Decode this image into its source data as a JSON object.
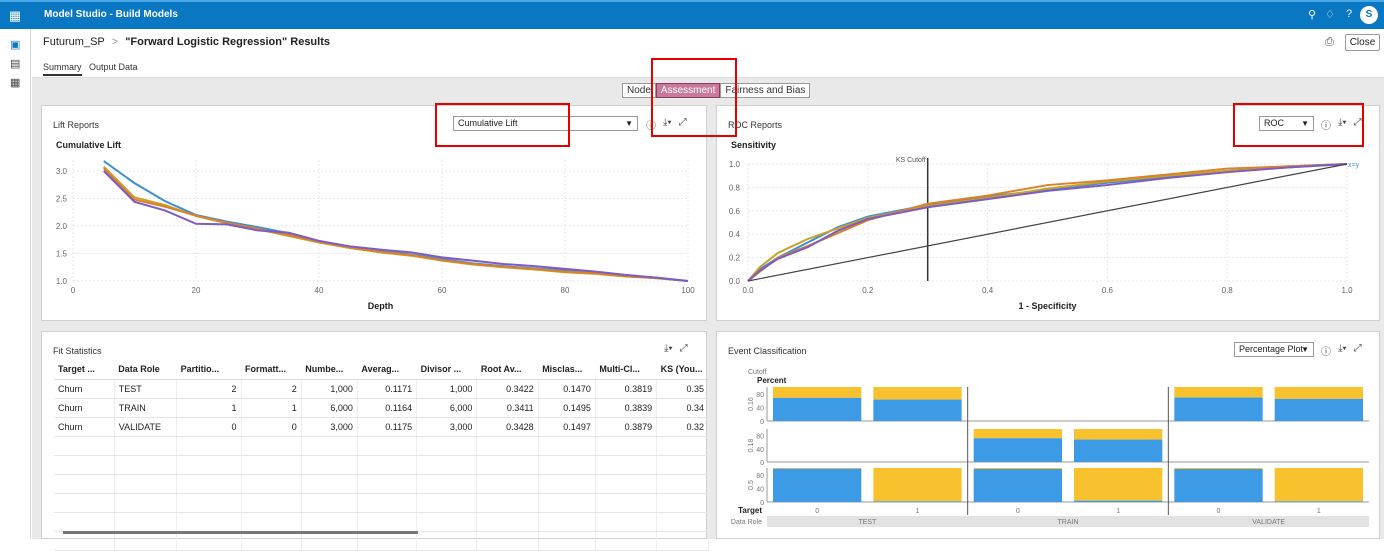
{
  "app": {
    "title": "Model Studio - Build Models",
    "apps_icon": "grid-icon",
    "avatar": "S"
  },
  "header_icons": [
    "search-icon",
    "notification-icon",
    "help-icon"
  ],
  "header_help": "?",
  "breadcrumb": {
    "project": "Futurum_SP",
    "separator": ">",
    "current": "\"Forward Logistic Regression\" Results"
  },
  "close_label": "Close",
  "tabs": {
    "summary": "Summary",
    "output": "Output Data"
  },
  "segments": {
    "node": "Node",
    "assessment": "Assessment",
    "fairness": "Fairness and Bias"
  },
  "lift": {
    "title": "Lift Reports",
    "select": "Cumulative Lift",
    "chart_title": "Cumulative Lift",
    "yticks": [
      "3.0",
      "2.5",
      "2.0",
      "1.5",
      "1.0"
    ],
    "xticks": [
      "0",
      "20",
      "40",
      "60",
      "80",
      "100"
    ],
    "xlabel": "Depth"
  },
  "roc": {
    "title": "ROC Reports",
    "select": "ROC",
    "chart_title": "Sensitivity",
    "yticks": [
      "1.0",
      "0.8",
      "0.6",
      "0.4",
      "0.2",
      "0.0"
    ],
    "xticks": [
      "0.0",
      "0.2",
      "0.4",
      "0.6",
      "0.8",
      "1.0"
    ],
    "xlabel": "1 - Specificity",
    "ks": "KS Cutoff",
    "xy_label": "x=y"
  },
  "fit": {
    "title": "Fit Statistics",
    "headers": [
      "Target ...",
      "Data Role",
      "Partitio...",
      "Formatt...",
      "Numbe...",
      "Averag...",
      "Divisor ...",
      "Root Av...",
      "Misclas...",
      "Multi-Cl...",
      "KS (You..."
    ],
    "rows": [
      [
        "Churn",
        "TEST",
        "2",
        "2",
        "1,000",
        "0.1171",
        "1,000",
        "0.3422",
        "0.1470",
        "0.3819",
        "0.35"
      ],
      [
        "Churn",
        "TRAIN",
        "1",
        "1",
        "6,000",
        "0.1164",
        "6,000",
        "0.3411",
        "0.1495",
        "0.3839",
        "0.34"
      ],
      [
        "Churn",
        "VALIDATE",
        "0",
        "0",
        "3,000",
        "0.1175",
        "3,000",
        "0.3428",
        "0.1497",
        "0.3879",
        "0.32"
      ]
    ]
  },
  "event": {
    "title": "Event Classification",
    "select": "Percentage Plot",
    "cutoff": "Cutoff",
    "percent": "Percent",
    "row_labels": [
      "0.16",
      "0.18",
      "0.5"
    ],
    "yticks": [
      "80",
      "40",
      "0"
    ],
    "target_label": "Target",
    "role_label": "Data Role",
    "targets": [
      "0",
      "1",
      "0",
      "1",
      "0",
      "1"
    ],
    "roles": [
      "TEST",
      "TRAIN",
      "VALIDATE"
    ]
  },
  "chart_data": [
    {
      "type": "line",
      "title": "Cumulative Lift",
      "xlabel": "Depth",
      "ylabel": "",
      "xlim": [
        0,
        100
      ],
      "ylim": [
        1.0,
        3.2
      ],
      "grid": true,
      "series": [
        {
          "color": "#3b8fd1",
          "x": [
            5,
            10,
            15,
            20,
            25,
            30,
            35,
            40,
            45,
            50,
            55,
            60,
            65,
            70,
            75,
            80,
            85,
            90,
            95,
            100
          ],
          "y": [
            3.18,
            2.78,
            2.45,
            2.2,
            2.08,
            1.98,
            1.87,
            1.72,
            1.62,
            1.55,
            1.48,
            1.4,
            1.32,
            1.27,
            1.23,
            1.19,
            1.15,
            1.1,
            1.06,
            1.0
          ]
        },
        {
          "color": "#c8a12a",
          "x": [
            5,
            10,
            15,
            20,
            25,
            30,
            35,
            40,
            45,
            50,
            55,
            60,
            65,
            70,
            75,
            80,
            85,
            90,
            95,
            100
          ],
          "y": [
            3.08,
            2.52,
            2.38,
            2.18,
            2.05,
            1.94,
            1.82,
            1.7,
            1.6,
            1.52,
            1.46,
            1.37,
            1.3,
            1.25,
            1.21,
            1.16,
            1.13,
            1.08,
            1.05,
            1.0
          ]
        },
        {
          "color": "#d9822b",
          "x": [
            5,
            10,
            15,
            20,
            25,
            30,
            35,
            40,
            45,
            50,
            55,
            60,
            65,
            70,
            75,
            80,
            85,
            90,
            95,
            100
          ],
          "y": [
            3.05,
            2.48,
            2.35,
            2.19,
            2.06,
            1.95,
            1.84,
            1.71,
            1.61,
            1.53,
            1.47,
            1.38,
            1.31,
            1.26,
            1.22,
            1.17,
            1.14,
            1.09,
            1.05,
            1.0
          ]
        },
        {
          "color": "#7d5cc6",
          "x": [
            5,
            10,
            15,
            20,
            25,
            30,
            35,
            40,
            45,
            50,
            55,
            60,
            65,
            70,
            75,
            80,
            85,
            90,
            95,
            100
          ],
          "y": [
            3.0,
            2.44,
            2.28,
            2.04,
            2.03,
            1.92,
            1.88,
            1.73,
            1.63,
            1.57,
            1.52,
            1.43,
            1.37,
            1.31,
            1.27,
            1.22,
            1.17,
            1.11,
            1.06,
            1.0
          ]
        }
      ]
    },
    {
      "type": "line",
      "title": "Sensitivity",
      "xlabel": "1 - Specificity",
      "ylabel": "",
      "xlim": [
        0,
        1
      ],
      "ylim": [
        0,
        1
      ],
      "ks_cutoff_x": 0.3,
      "grid": true,
      "series": [
        {
          "color": "#3b8fd1",
          "x": [
            0,
            0.02,
            0.05,
            0.1,
            0.15,
            0.2,
            0.3,
            0.4,
            0.5,
            0.6,
            0.7,
            0.8,
            0.9,
            1.0
          ],
          "y": [
            0,
            0.1,
            0.2,
            0.33,
            0.46,
            0.55,
            0.65,
            0.72,
            0.78,
            0.84,
            0.89,
            0.94,
            0.98,
            1.0
          ]
        },
        {
          "color": "#c8a12a",
          "x": [
            0,
            0.02,
            0.05,
            0.1,
            0.15,
            0.2,
            0.3,
            0.4,
            0.5,
            0.6,
            0.7,
            0.8,
            0.9,
            1.0
          ],
          "y": [
            0,
            0.12,
            0.24,
            0.36,
            0.45,
            0.54,
            0.64,
            0.71,
            0.79,
            0.85,
            0.9,
            0.94,
            0.97,
            1.0
          ]
        },
        {
          "color": "#d9822b",
          "x": [
            0,
            0.02,
            0.05,
            0.1,
            0.15,
            0.2,
            0.3,
            0.4,
            0.5,
            0.6,
            0.7,
            0.8,
            0.9,
            1.0
          ],
          "y": [
            0,
            0.08,
            0.2,
            0.3,
            0.41,
            0.52,
            0.66,
            0.73,
            0.82,
            0.86,
            0.91,
            0.96,
            0.98,
            1.0
          ]
        },
        {
          "color": "#7d5cc6",
          "x": [
            0,
            0.02,
            0.05,
            0.1,
            0.15,
            0.2,
            0.3,
            0.4,
            0.5,
            0.6,
            0.7,
            0.8,
            0.9,
            1.0
          ],
          "y": [
            0,
            0.09,
            0.19,
            0.29,
            0.43,
            0.53,
            0.63,
            0.7,
            0.77,
            0.82,
            0.88,
            0.93,
            0.97,
            1.0
          ]
        },
        {
          "color": "#444444",
          "x": [
            0,
            1
          ],
          "y": [
            0,
            1
          ]
        }
      ]
    },
    {
      "type": "bar",
      "title": "Event Classification",
      "note": "fractions: blue (bottom) portion of 100% bars",
      "cutoffs": [
        "0.16",
        "0.18",
        "0.5"
      ],
      "groups": [
        "TEST 0",
        "TEST 1",
        "TRAIN 0",
        "TRAIN 1",
        "VALIDATE 0",
        "VALIDATE 1"
      ],
      "colors": {
        "blue": "#3d9be5",
        "gold": "#f8c22f"
      },
      "rows": [
        {
          "cutoff": "0.16",
          "role_cols": [
            0,
            2
          ],
          "blue": [
            0.68,
            0.63,
            null,
            null,
            0.69,
            0.65
          ]
        },
        {
          "cutoff": "0.18",
          "role_cols": [
            1
          ],
          "blue": [
            null,
            null,
            0.72,
            0.68,
            null,
            null
          ]
        },
        {
          "cutoff": "0.5",
          "role_cols": [
            0,
            1,
            2
          ],
          "blue": [
            0.98,
            0.02,
            0.97,
            0.04,
            0.97,
            0.02
          ]
        }
      ]
    }
  ]
}
